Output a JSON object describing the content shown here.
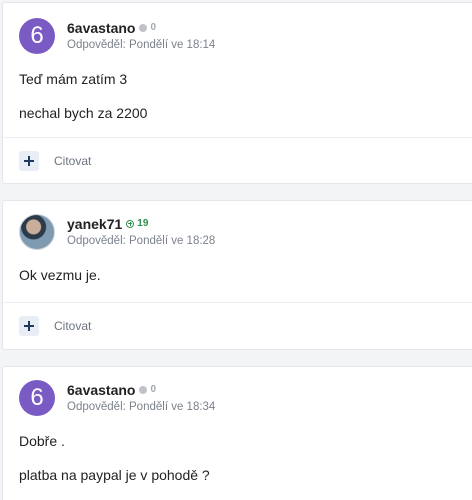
{
  "posts": [
    {
      "username": "6avastano",
      "avatar_letter": "6",
      "avatar_color": "#7a5bc4",
      "reputation": "0",
      "reputation_status": "neutral",
      "timestamp": "Odpověděl: Pondělí ve 18:14",
      "body": [
        "Teď mám zatím 3",
        "nechal bych za 2200"
      ],
      "actions": {
        "plus_icon": "plus-icon",
        "quote_label": "Citovat"
      }
    },
    {
      "username": "yanek71",
      "avatar_letter": "",
      "reputation": "19",
      "reputation_status": "positive",
      "timestamp": "Odpověděl: Pondělí ve 18:28",
      "body": [
        "Ok vezmu je."
      ],
      "actions": {
        "plus_icon": "plus-icon",
        "quote_label": "Citovat"
      }
    },
    {
      "username": "6avastano",
      "avatar_letter": "6",
      "avatar_color": "#7a5bc4",
      "reputation": "0",
      "reputation_status": "neutral",
      "timestamp": "Odpověděl: Pondělí ve 18:34",
      "body": [
        "Dobře .",
        "platba na paypal je v pohodě ?"
      ]
    }
  ],
  "colors": {
    "accent_dark": "#1f3a5f",
    "reputation_positive": "#2f8f4e",
    "reputation_neutral": "#a3a8b0"
  }
}
